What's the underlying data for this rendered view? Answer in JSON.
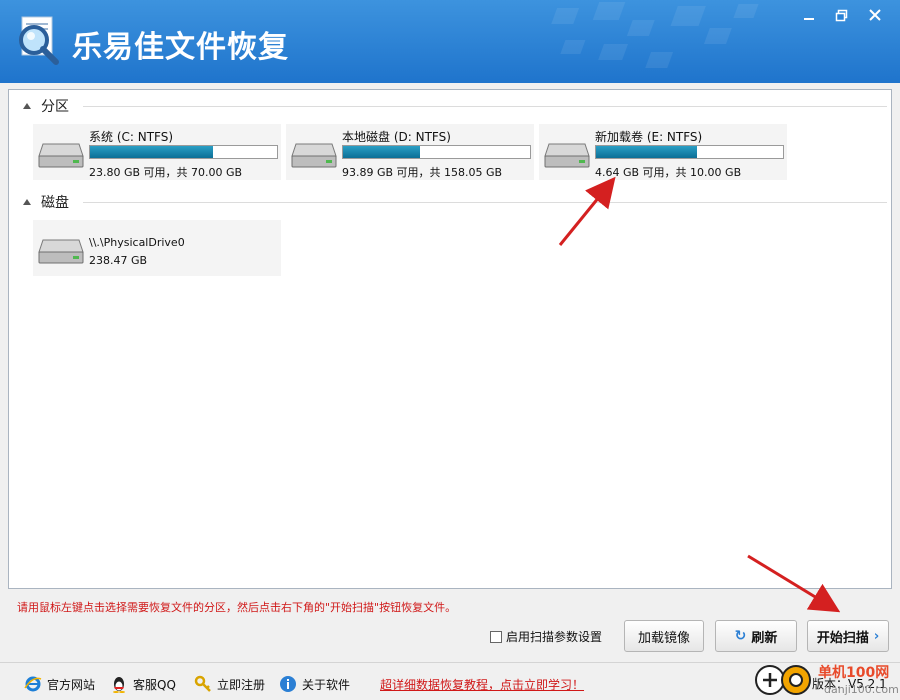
{
  "window": {
    "title": "乐易佳文件恢复"
  },
  "sections": {
    "partitions_label": "分区",
    "disks_label": "磁盘"
  },
  "partitions": [
    {
      "name": "系统 (C: NTFS)",
      "info": "23.80 GB 可用，共 70.00 GB",
      "used_fraction": 0.66
    },
    {
      "name": "本地磁盘 (D: NTFS)",
      "info": "93.89 GB 可用，共 158.05 GB",
      "used_fraction": 0.41
    },
    {
      "name": "新加载卷 (E: NTFS)",
      "info": "4.64 GB 可用，共 10.00 GB",
      "used_fraction": 0.54
    }
  ],
  "disks": [
    {
      "name": "\\\\.\\PhysicalDrive0",
      "info": "238.47 GB"
    }
  ],
  "hint": "请用鼠标左键点击选择需要恢复文件的分区，然后点击右下角的\"开始扫描\"按钮恢复文件。",
  "toolbar": {
    "scan_params_label": "启用扫描参数设置",
    "load_image_label": "加载镜像",
    "refresh_label": "刷新",
    "start_scan_label": "开始扫描"
  },
  "footer": {
    "website": "官方网站",
    "support_qq": "客服QQ",
    "register": "立即注册",
    "about": "关于软件",
    "promo": "超详细数据恢复教程，点击立即学习！",
    "version": "版本：V5.2.1"
  },
  "watermark": {
    "text": "单机100网",
    "url": "danji100.com"
  },
  "colors": {
    "titlebar": "#2a82d6",
    "accent": "#2b7fd4",
    "progress": "#127fa8",
    "hint": "#d01818"
  }
}
